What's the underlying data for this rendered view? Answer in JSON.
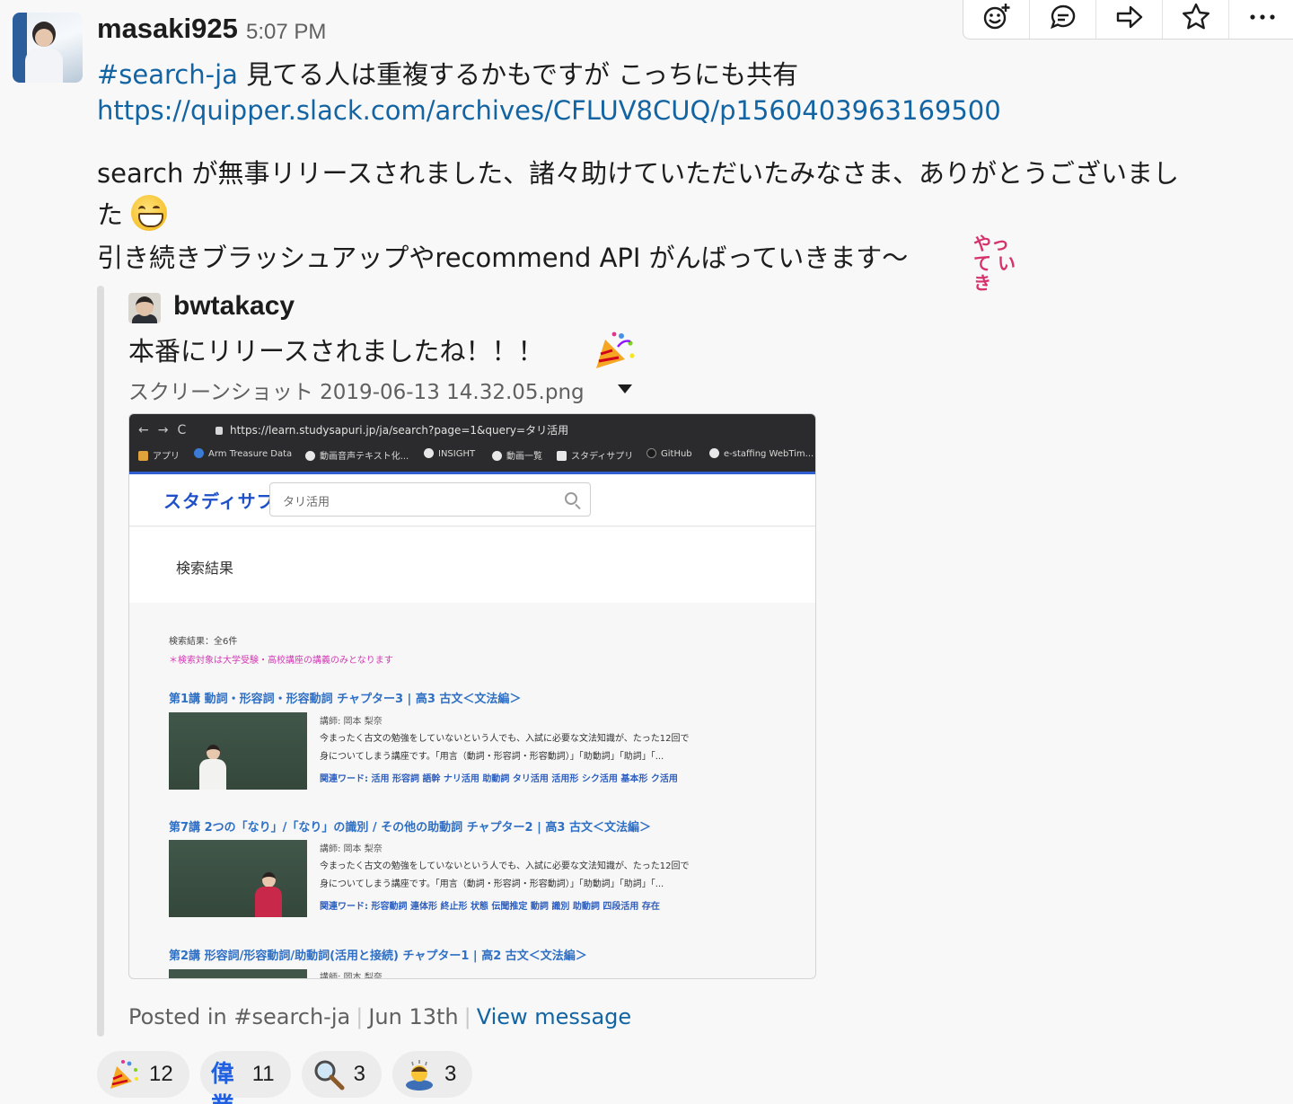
{
  "toolbar": {
    "icons": [
      "add-reaction-icon",
      "comment-icon",
      "share-icon",
      "star-icon",
      "more-icon"
    ]
  },
  "message": {
    "author": "masaki925",
    "time": "5:07 PM",
    "line1_channel": "#search-ja",
    "line1_text": " 見てる人は重複するかもですが こっちにも共有",
    "line2_url": "https://quipper.slack.com/archives/CFLUV8CUQ/p1560403963169500",
    "line3_text": "search が無事リリースされました、諸々助けていただいたみなさま、ありがとうございまし",
    "line4_text": "た ",
    "line5_text": "引き続きブラッシュアップやrecommend API がんばっていきます〜",
    "custom_emoji_text": "やって いき"
  },
  "quote": {
    "author": "bwtakacy",
    "text": "本番にリリースされましたね！！！",
    "file_name": "スクリーンショット 2019-06-13 14.32.05.png",
    "footer_posted": "Posted in #search-ja",
    "footer_date": "Jun 13th",
    "footer_view": "View message"
  },
  "screenshot": {
    "url": "https://learn.studysapuri.jp/ja/search?page=1&query=タリ活用",
    "nav_glyphs": "←→C",
    "bookmarks": [
      "アプリ",
      "Arm Treasure Data",
      "動画音声テキスト化...",
      "INSIGHT",
      "動画一覧",
      "スタディサプリ",
      "GitHub",
      "e-staffing WebTim..."
    ],
    "logo": "スタディサプリ",
    "search_value": "タリ活用",
    "results_heading": "検索結果",
    "count": "検索結果：全6件",
    "note": "＊検索対象は大学受験・高校講座の講義のみとなります",
    "results": [
      {
        "title": "第1講 動詞・形容詞・形容動詞 チャプター3 | 高3 古文＜文法編＞",
        "teacher": "講師: 岡本 梨奈",
        "desc1": "今まったく古文の勉強をしていないという人でも、入試に必要な文法知識が、たった12回で",
        "desc2": "身についてしまう講座です。「用言（動詞・形容詞・形容動詞）」「助動詞」「助詞」「...",
        "keywords": "関連ワード: 活用 形容詞 語幹 ナリ活用 助動詞 タリ活用 活用形 シク活用 基本形 ク活用"
      },
      {
        "title": "第7講 2つの「なり」/「なり」の識別 / その他の助動詞 チャプター2 | 高3 古文＜文法編＞",
        "teacher": "講師: 岡本 梨奈",
        "desc1": "今まったく古文の勉強をしていないという人でも、入試に必要な文法知識が、たった12回で",
        "desc2": "身についてしまう講座です。「用言（動詞・形容詞・形容動詞）」「助動詞」「助詞」「...",
        "keywords": "関連ワード: 形容動詞 連体形 終止形 状態 伝聞推定 動詞 識別 助動詞 四段活用 存在"
      },
      {
        "title": "第2講 形容詞/形容動詞/助動詞(活用と接続) チャプター1 | 高2 古文＜文法編＞",
        "teacher": "講師: 岡本 梨奈"
      }
    ]
  },
  "reactions": [
    {
      "icon": "party-popper-icon",
      "count": "12"
    },
    {
      "icon": "igyo-icon",
      "label": "偉業",
      "count": "11"
    },
    {
      "icon": "magnifier-icon",
      "count": "3"
    },
    {
      "icon": "bowing-person-icon",
      "count": "3"
    }
  ]
}
